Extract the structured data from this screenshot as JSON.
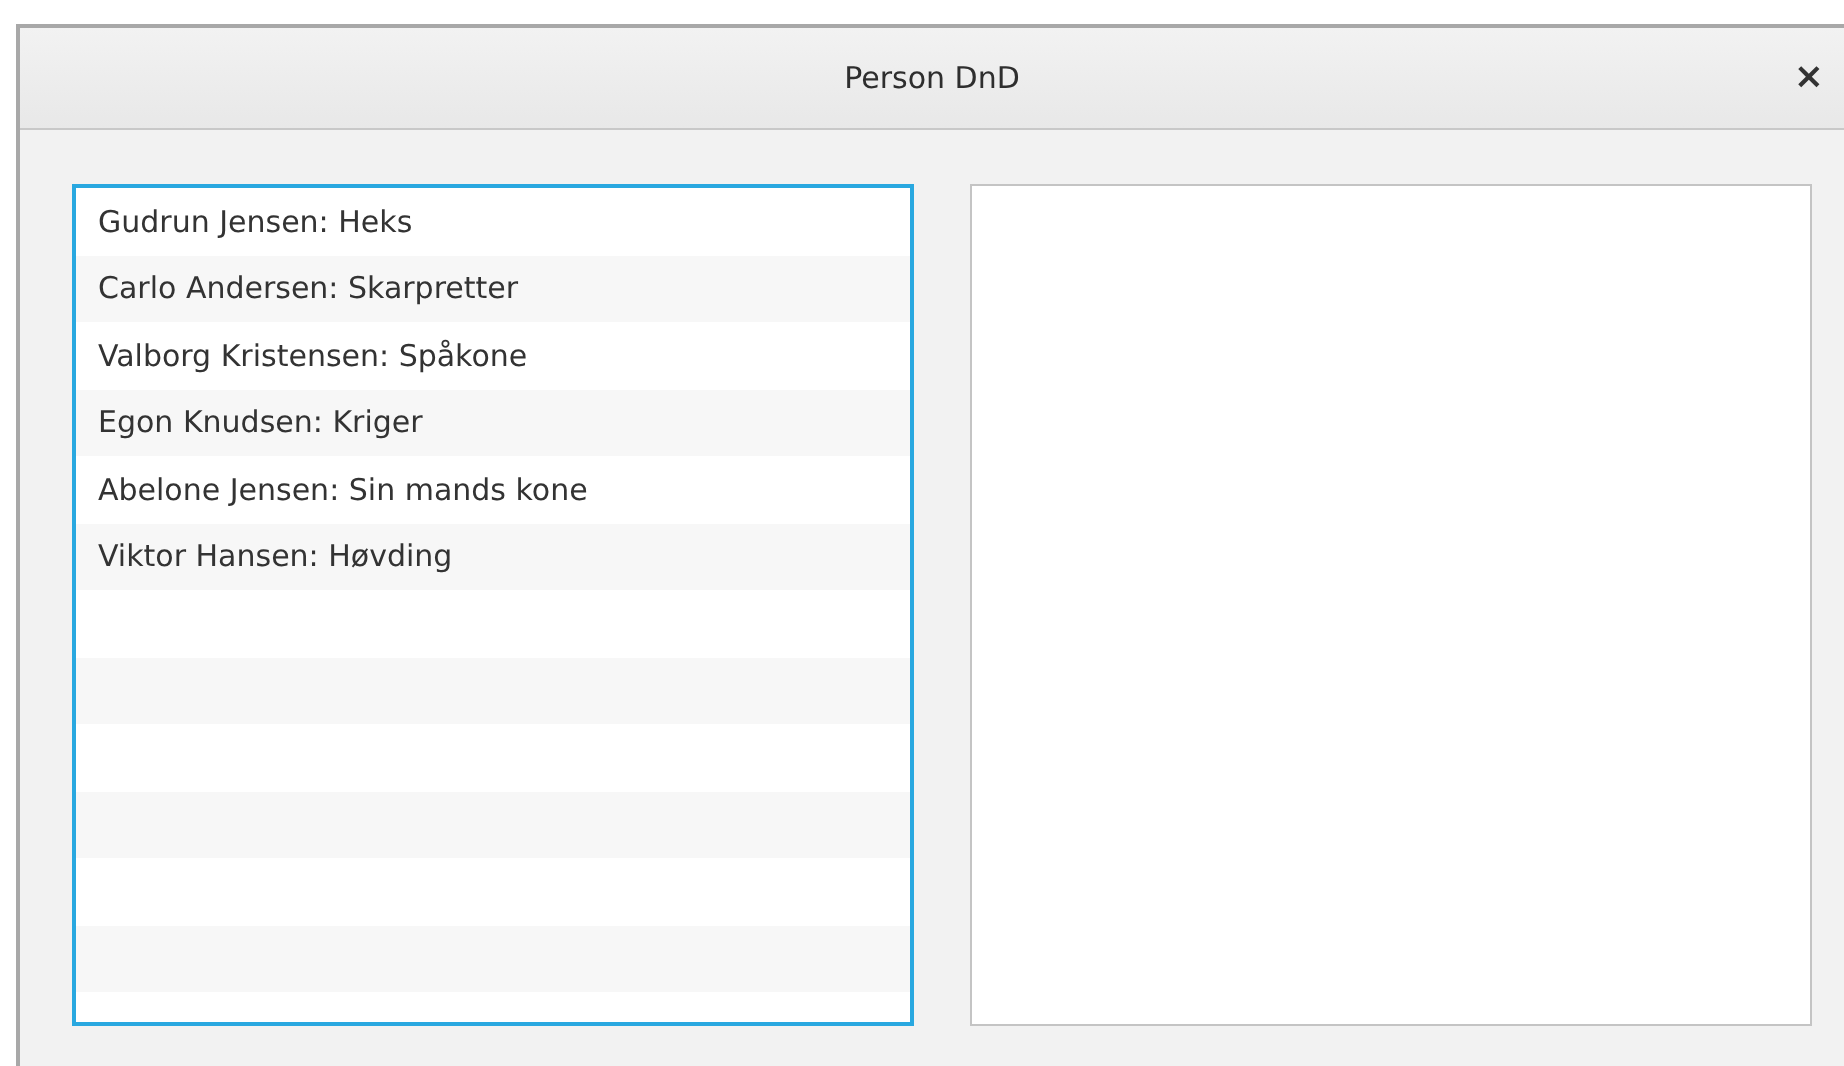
{
  "window": {
    "title": "Person DnD",
    "close": "×"
  },
  "lists": [
    {
      "focused": true,
      "items": [
        "Gudrun Jensen: Heks",
        "Carlo Andersen: Skarpretter",
        "Valborg Kristensen: Spåkone",
        "Egon Knudsen: Kriger",
        "Abelone Jensen: Sin mands kone",
        "Viktor Hansen: Høvding"
      ]
    },
    {
      "focused": false
    }
  ]
}
